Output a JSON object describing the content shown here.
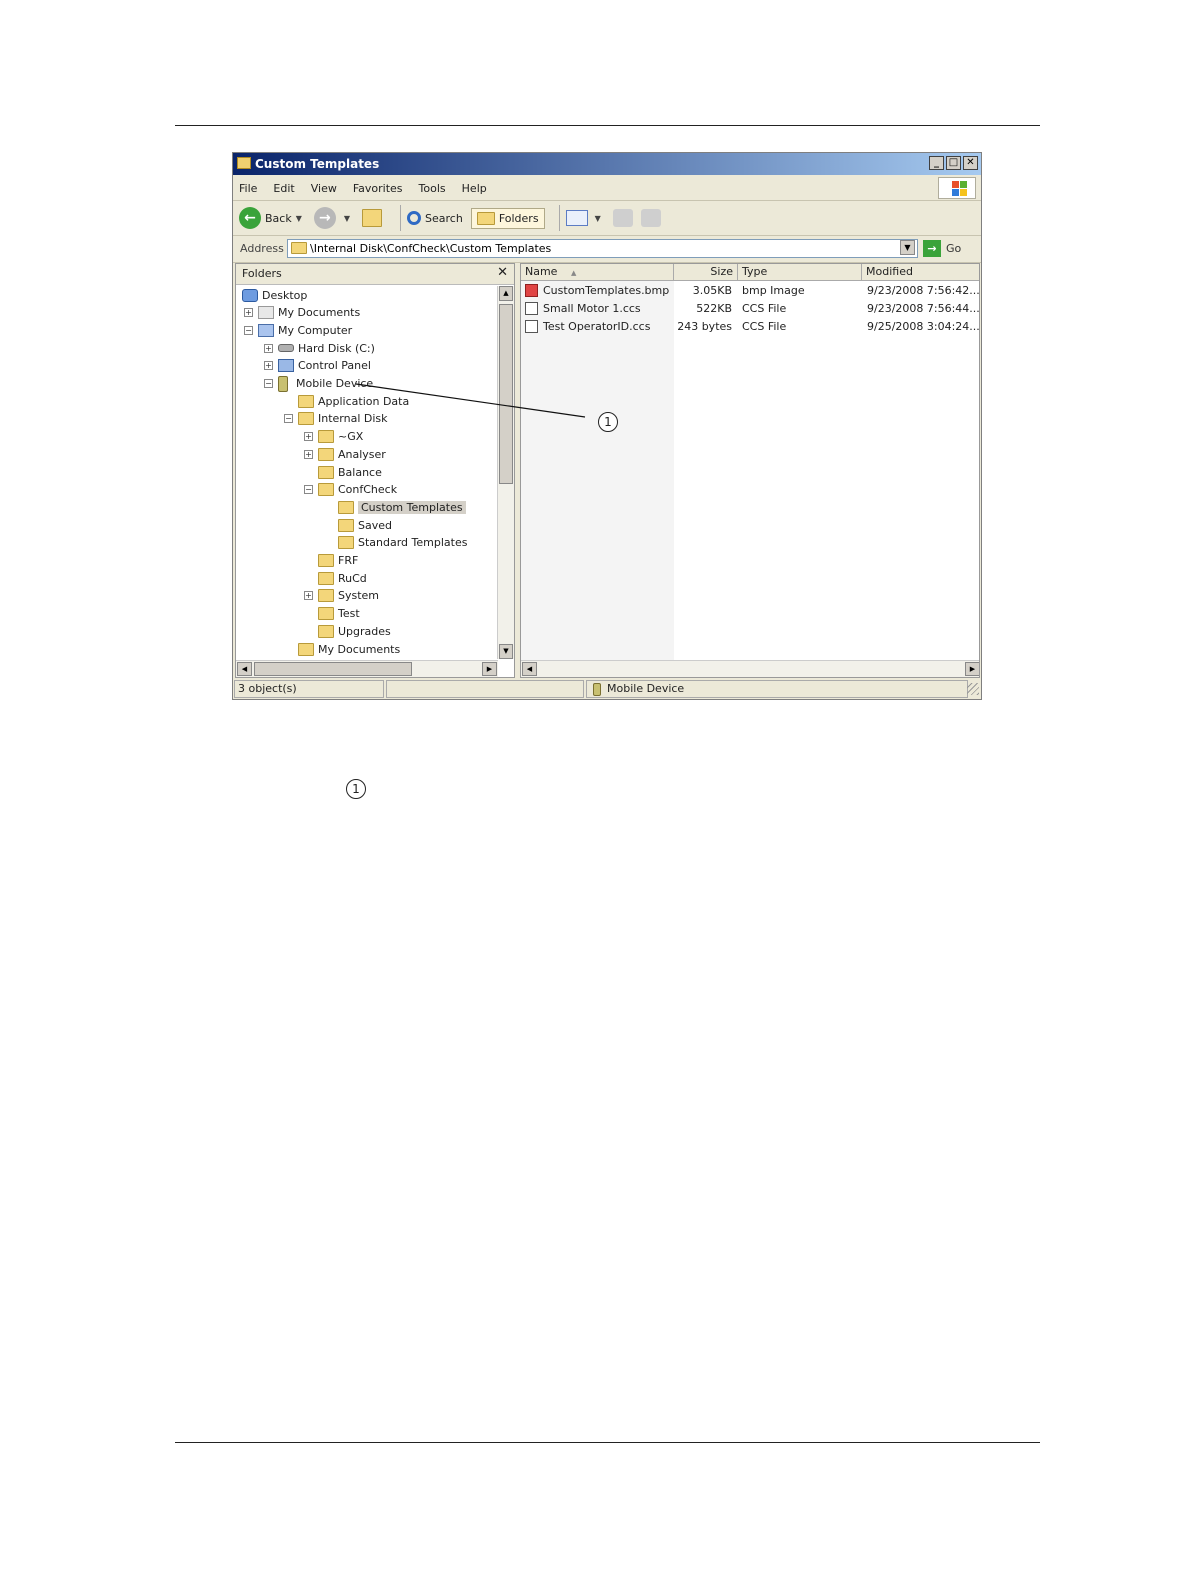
{
  "window": {
    "title": "Custom Templates",
    "buttons": {
      "minimize": "_",
      "maximize": "□",
      "close": "✕"
    }
  },
  "menu": [
    "File",
    "Edit",
    "View",
    "Favorites",
    "Tools",
    "Help"
  ],
  "toolbar": {
    "back": "Back",
    "search": "Search",
    "folders": "Folders"
  },
  "address": {
    "label": "Address",
    "value": "\\Internal Disk\\ConfCheck\\Custom Templates",
    "go": "Go"
  },
  "folders_pane": {
    "title": "Folders",
    "close": "✕",
    "tree": [
      {
        "label": "Desktop",
        "level": 0,
        "expander": "",
        "icon": "desktop"
      },
      {
        "label": "My Documents",
        "level": 1,
        "expander": "+",
        "icon": "docs"
      },
      {
        "label": "My Computer",
        "level": 1,
        "expander": "−",
        "icon": "computer"
      },
      {
        "label": "Hard Disk (C:)",
        "level": 2,
        "expander": "+",
        "icon": "disk"
      },
      {
        "label": "Control Panel",
        "level": 2,
        "expander": "+",
        "icon": "panel"
      },
      {
        "label": "Mobile Device",
        "level": 2,
        "expander": "−",
        "icon": "device"
      },
      {
        "label": "Application Data",
        "level": 3,
        "expander": "",
        "icon": "folder"
      },
      {
        "label": "Internal Disk",
        "level": 3,
        "expander": "−",
        "icon": "folder"
      },
      {
        "label": "~GX",
        "level": 4,
        "expander": "+",
        "icon": "folder"
      },
      {
        "label": "Analyser",
        "level": 4,
        "expander": "+",
        "icon": "folder"
      },
      {
        "label": "Balance",
        "level": 4,
        "expander": "",
        "icon": "folder"
      },
      {
        "label": "ConfCheck",
        "level": 4,
        "expander": "−",
        "icon": "folder"
      },
      {
        "label": "Custom Templates",
        "level": 5,
        "expander": "",
        "icon": "folder",
        "selected": true
      },
      {
        "label": "Saved",
        "level": 5,
        "expander": "",
        "icon": "folder"
      },
      {
        "label": "Standard Templates",
        "level": 5,
        "expander": "",
        "icon": "folder"
      },
      {
        "label": "FRF",
        "level": 4,
        "expander": "",
        "icon": "folder"
      },
      {
        "label": "RuCd",
        "level": 4,
        "expander": "",
        "icon": "folder"
      },
      {
        "label": "System",
        "level": 4,
        "expander": "+",
        "icon": "folder"
      },
      {
        "label": "Test",
        "level": 4,
        "expander": "",
        "icon": "folder"
      },
      {
        "label": "Upgrades",
        "level": 4,
        "expander": "",
        "icon": "folder"
      },
      {
        "label": "My Documents",
        "level": 3,
        "expander": "",
        "icon": "folder"
      }
    ]
  },
  "files_pane": {
    "columns": {
      "name": "Name",
      "size": "Size",
      "type": "Type",
      "modified": "Modified"
    },
    "sort_indicator": "▲",
    "rows": [
      {
        "name": "CustomTemplates.bmp",
        "size": "3.05KB",
        "type": "bmp Image",
        "modified": "9/23/2008  7:56:42...",
        "icon": "bmp"
      },
      {
        "name": "Small Motor 1.ccs",
        "size": "522KB",
        "type": "CCS File",
        "modified": "9/23/2008  7:56:44...",
        "icon": "ccs"
      },
      {
        "name": "Test OperatorID.ccs",
        "size": "243 bytes",
        "type": "CCS File",
        "modified": "9/25/2008  3:04:24...",
        "icon": "ccs"
      }
    ]
  },
  "status": {
    "objects": "3 object(s)",
    "location": "Mobile Device"
  },
  "callouts": {
    "one": "1"
  }
}
